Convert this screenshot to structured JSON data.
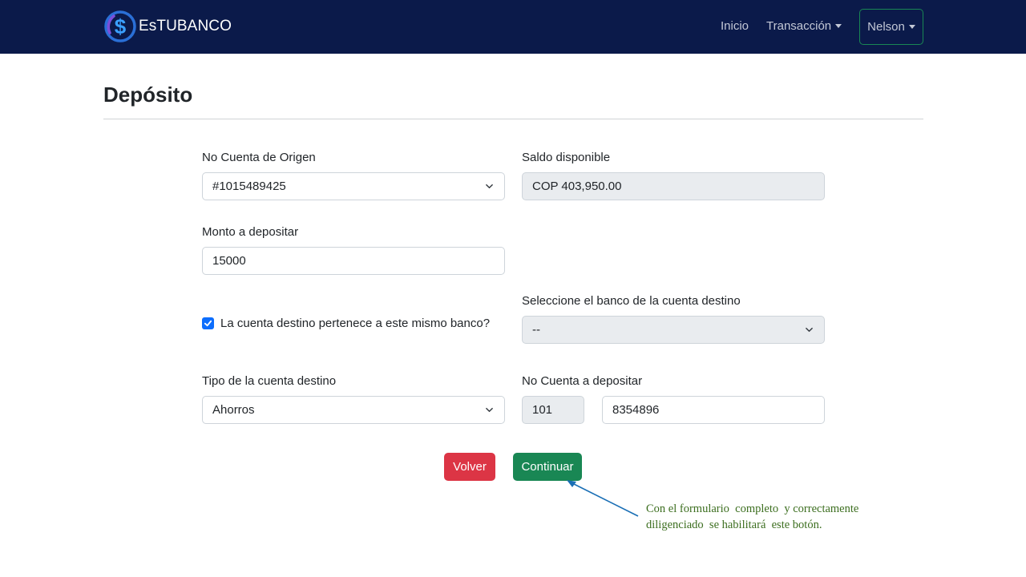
{
  "app": {
    "brand": "EsTUBANCO",
    "logo_icon": "dollar-coin-icon"
  },
  "nav": {
    "home": "Inicio",
    "transactions": "Transacción",
    "user": "Nelson"
  },
  "page": {
    "title": "Depósito"
  },
  "form": {
    "origin_account": {
      "label": "No Cuenta de Origen",
      "value": "#1015489425"
    },
    "balance": {
      "label": "Saldo disponible",
      "value": "COP 403,950.00"
    },
    "amount": {
      "label": "Monto a depositar",
      "value": "15000"
    },
    "same_bank": {
      "label": "La cuenta destino pertenece a este mismo banco?",
      "checked": true
    },
    "dest_bank": {
      "label": "Seleccione el banco de la cuenta destino",
      "value": "--"
    },
    "dest_type": {
      "label": "Tipo de la cuenta destino",
      "value": "Ahorros"
    },
    "dest_account": {
      "label": "No Cuenta a depositar",
      "prefix": "101",
      "number": "8354896"
    }
  },
  "buttons": {
    "back": "Volver",
    "continue": "Continuar"
  },
  "annotation": {
    "line1": "Con el formulario  completo  y correctamente",
    "line2": "diligenciado  se habilitará  este botón."
  },
  "colors": {
    "navbar": "#0b1a4a",
    "primary": "#0d6efd",
    "danger": "#dc3545",
    "success": "#198754",
    "annotation_text": "#3c6e1f",
    "annotation_arrow": "#1a6fb5"
  }
}
